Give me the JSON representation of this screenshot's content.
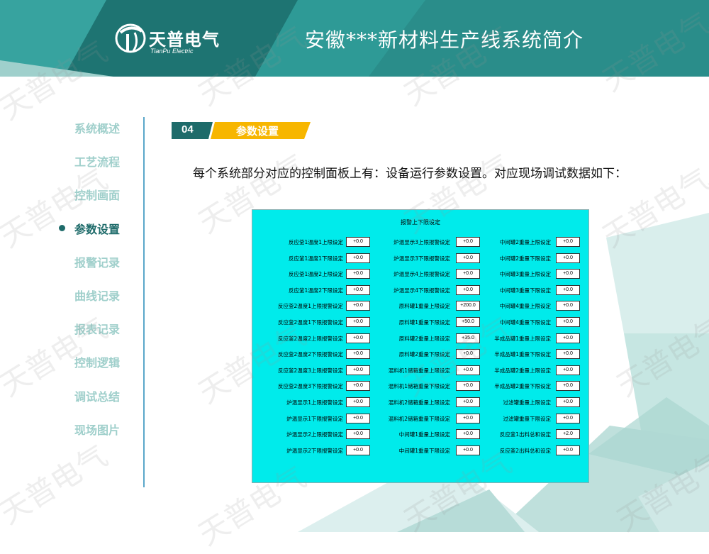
{
  "header": {
    "title": "安徽***新材料生产线系统简介",
    "logo_cn": "天普电气",
    "logo_en": "TianPu Electric"
  },
  "colors": {
    "teal_dark": "#1e6b6a",
    "teal_mid": "#2e9a96",
    "teal_light": "#9fcfcb",
    "accent_yellow": "#f7b600",
    "panel_cyan": "#00ebeb"
  },
  "sidebar": {
    "items": [
      {
        "label": "系统概述"
      },
      {
        "label": "工艺流程"
      },
      {
        "label": "控制画面"
      },
      {
        "label": "参数设置",
        "active": true
      },
      {
        "label": "报警记录"
      },
      {
        "label": "曲线记录"
      },
      {
        "label": "报表记录"
      },
      {
        "label": "控制逻辑"
      },
      {
        "label": "调试总结"
      },
      {
        "label": "现场图片"
      }
    ]
  },
  "section": {
    "number": "04",
    "title": "参数设置"
  },
  "description": "每个系统部分对应的控制面板上有：设备运行参数设置。对应现场调试数据如下：",
  "panel": {
    "title": "报警上下限设定",
    "columns": [
      [
        {
          "label": "反应釜1温度1上限设定",
          "value": "+0.0"
        },
        {
          "label": "反应釜1温度1下限设定",
          "value": "+0.0"
        },
        {
          "label": "反应釜1温度2上限设定",
          "value": "+0.0"
        },
        {
          "label": "反应釜1温度2下限设定",
          "value": "+0.0"
        },
        {
          "label": "反应釜2温度1上限报警设定",
          "value": "+0.0"
        },
        {
          "label": "反应釜2温度1下限报警设定",
          "value": "+0.0"
        },
        {
          "label": "反应釜2温度2上限报警设定",
          "value": "+0.0"
        },
        {
          "label": "反应釜2温度2下限报警设定",
          "value": "+0.0"
        },
        {
          "label": "反应釜2温度3上限报警设定",
          "value": "+0.0"
        },
        {
          "label": "反应釜2温度3下限报警设定",
          "value": "+0.0"
        },
        {
          "label": "炉温显示1上限报警设定",
          "value": "+0.0"
        },
        {
          "label": "炉温显示1下限报警设定",
          "value": "+0.0"
        },
        {
          "label": "炉温显示2上限报警设定",
          "value": "+0.0"
        },
        {
          "label": "炉温显示2下限报警设定",
          "value": "+0.0"
        }
      ],
      [
        {
          "label": "炉温显示3上限报警设定",
          "value": "+0.0"
        },
        {
          "label": "炉温显示3下限报警设定",
          "value": "+0.0"
        },
        {
          "label": "炉温显示4上限报警设定",
          "value": "+0.0"
        },
        {
          "label": "炉温显示4下限报警设定",
          "value": "+0.0"
        },
        {
          "label": "原料罐1重量上限设定",
          "value": "+200.0"
        },
        {
          "label": "原料罐1重量下限设定",
          "value": "+50.0"
        },
        {
          "label": "原料罐2重量上限设定",
          "value": "+35.0"
        },
        {
          "label": "原料罐2重量下限设定",
          "value": "+0.0"
        },
        {
          "label": "混料机1储箱重量上限设定",
          "value": "+0.0"
        },
        {
          "label": "混料机1储箱重量下限设定",
          "value": "+0.0"
        },
        {
          "label": "混料机2储箱重量上限设定",
          "value": "+0.0"
        },
        {
          "label": "混料机2储箱重量下限设定",
          "value": "+0.0"
        },
        {
          "label": "中间罐1重量上限设定",
          "value": "+0.0"
        },
        {
          "label": "中间罐1重量下限设定",
          "value": "+0.0"
        }
      ],
      [
        {
          "label": "中间罐2重量上限设定",
          "value": "+0.0"
        },
        {
          "label": "中间罐2重量下限设定",
          "value": "+0.0"
        },
        {
          "label": "中间罐3重量上限设定",
          "value": "+0.0"
        },
        {
          "label": "中间罐3重量下限设定",
          "value": "+0.0"
        },
        {
          "label": "中间罐4重量上限设定",
          "value": "+0.0"
        },
        {
          "label": "中间罐4重量下限设定",
          "value": "+0.0"
        },
        {
          "label": "半成品罐1重量上限设定",
          "value": "+0.0"
        },
        {
          "label": "半成品罐1重量下限设定",
          "value": "+0.0"
        },
        {
          "label": "半成品罐2重量上限设定",
          "value": "+0.0"
        },
        {
          "label": "半成品罐2重量下限设定",
          "value": "+0.0"
        },
        {
          "label": "过滤罐重量上限设定",
          "value": "+0.0"
        },
        {
          "label": "过滤罐重量下限设定",
          "value": "+0.0"
        },
        {
          "label": "反应釜1出料总和设定",
          "value": "+2.0"
        },
        {
          "label": "反应釜2出料总和设定",
          "value": "+0.0"
        }
      ]
    ]
  },
  "watermark": "天普电气"
}
